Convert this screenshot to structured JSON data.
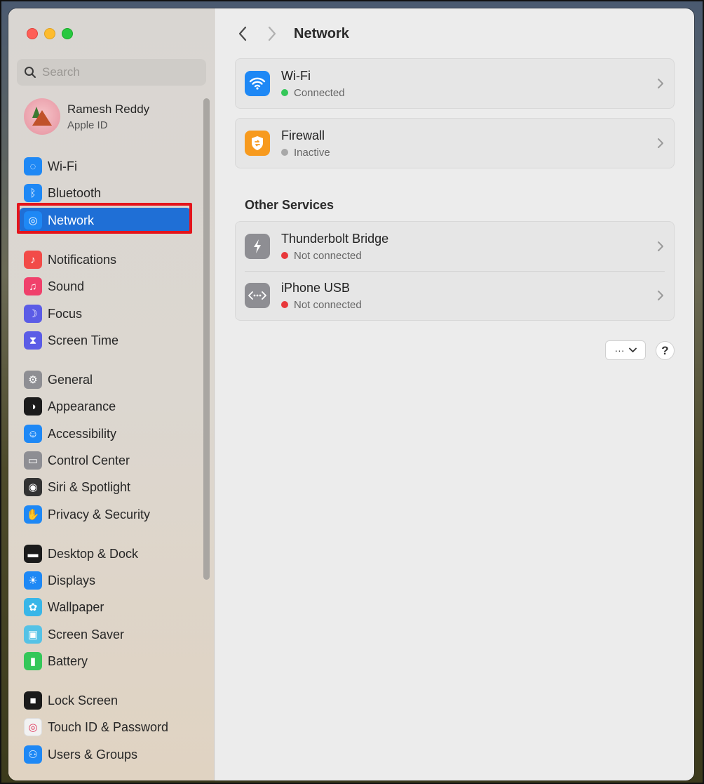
{
  "window": {
    "title": "Network"
  },
  "search": {
    "placeholder": "Search"
  },
  "profile": {
    "name": "Ramesh Reddy",
    "subtitle": "Apple ID"
  },
  "sidebar": {
    "items": [
      {
        "label": "Wi-Fi",
        "icon": "wifi-icon",
        "color": "#1e88f5"
      },
      {
        "label": "Bluetooth",
        "icon": "bluetooth-icon",
        "color": "#1e88f5"
      },
      {
        "label": "Network",
        "icon": "globe-icon",
        "color": "#1e88f5",
        "active": true
      },
      {
        "label": "Notifications",
        "icon": "bell-icon",
        "color": "#f24b48"
      },
      {
        "label": "Sound",
        "icon": "speaker-icon",
        "color": "#f0406b"
      },
      {
        "label": "Focus",
        "icon": "moon-icon",
        "color": "#5b5ce6"
      },
      {
        "label": "Screen Time",
        "icon": "hourglass-icon",
        "color": "#5b5ce6"
      },
      {
        "label": "General",
        "icon": "gear-icon",
        "color": "#8e8e93"
      },
      {
        "label": "Appearance",
        "icon": "appearance-icon",
        "color": "#1b1b1b"
      },
      {
        "label": "Accessibility",
        "icon": "accessibility-icon",
        "color": "#1e88f5"
      },
      {
        "label": "Control Center",
        "icon": "toggles-icon",
        "color": "#8e8e93"
      },
      {
        "label": "Siri & Spotlight",
        "icon": "siri-icon",
        "color": "#333333"
      },
      {
        "label": "Privacy & Security",
        "icon": "hand-icon",
        "color": "#1e88f5"
      },
      {
        "label": "Desktop & Dock",
        "icon": "dock-icon",
        "color": "#1b1b1b"
      },
      {
        "label": "Displays",
        "icon": "sun-icon",
        "color": "#1e88f5"
      },
      {
        "label": "Wallpaper",
        "icon": "flower-icon",
        "color": "#38b6e8"
      },
      {
        "label": "Screen Saver",
        "icon": "screensaver-icon",
        "color": "#55c2e6"
      },
      {
        "label": "Battery",
        "icon": "battery-icon",
        "color": "#34c759"
      },
      {
        "label": "Lock Screen",
        "icon": "lock-icon",
        "color": "#1b1b1b"
      },
      {
        "label": "Touch ID & Password",
        "icon": "fingerprint-icon",
        "color": "#f2f2f2"
      },
      {
        "label": "Users & Groups",
        "icon": "users-icon",
        "color": "#1e88f5"
      }
    ]
  },
  "services": [
    {
      "title": "Wi-Fi",
      "status": "Connected",
      "status_color": "#34c759",
      "icon": "wifi-icon"
    },
    {
      "title": "Firewall",
      "status": "Inactive",
      "status_color": "#a8a8a8",
      "icon": "firewall-icon"
    }
  ],
  "other_services": {
    "heading": "Other Services",
    "items": [
      {
        "title": "Thunderbolt Bridge",
        "status": "Not connected",
        "status_color": "#e8383b",
        "icon": "thunderbolt-icon"
      },
      {
        "title": "iPhone USB",
        "status": "Not connected",
        "status_color": "#e8383b",
        "icon": "usb-icon"
      }
    ]
  },
  "actions": {
    "more_label": "···",
    "help_label": "?"
  },
  "colors": {
    "accent": "#1f6fd6",
    "highlight": "#e4141b"
  }
}
